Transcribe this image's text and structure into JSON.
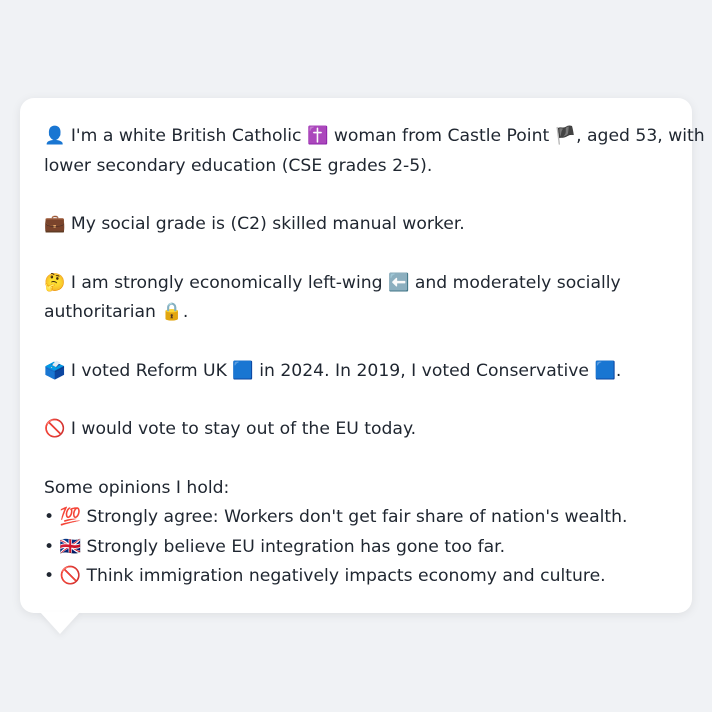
{
  "profile": {
    "identity_line1": "👤 I'm a white British Catholic ✝️ woman from Castle Point 🏴, aged 53, with",
    "identity_line2": "lower secondary education (CSE grades 2-5).",
    "grade": "💼 My social grade is (C2) skilled manual worker.",
    "politics_line1": "🤔 I am strongly economically left-wing ⬅️ and moderately socially",
    "politics_line2": "authoritarian 🔒.",
    "votes": "🗳️ I voted Reform UK 🟦 in 2024. In 2019, I voted Conservative 🟦.",
    "eu": "🚫 I would vote to stay out of the EU today."
  },
  "opinions": {
    "heading": "Some opinions I hold:",
    "items": [
      "• 💯 Strongly agree: Workers don't get fair share of nation's wealth.",
      "• 🇬🇧 Strongly believe EU integration has gone too far.",
      "• 🚫 Think immigration negatively impacts economy and culture."
    ]
  }
}
